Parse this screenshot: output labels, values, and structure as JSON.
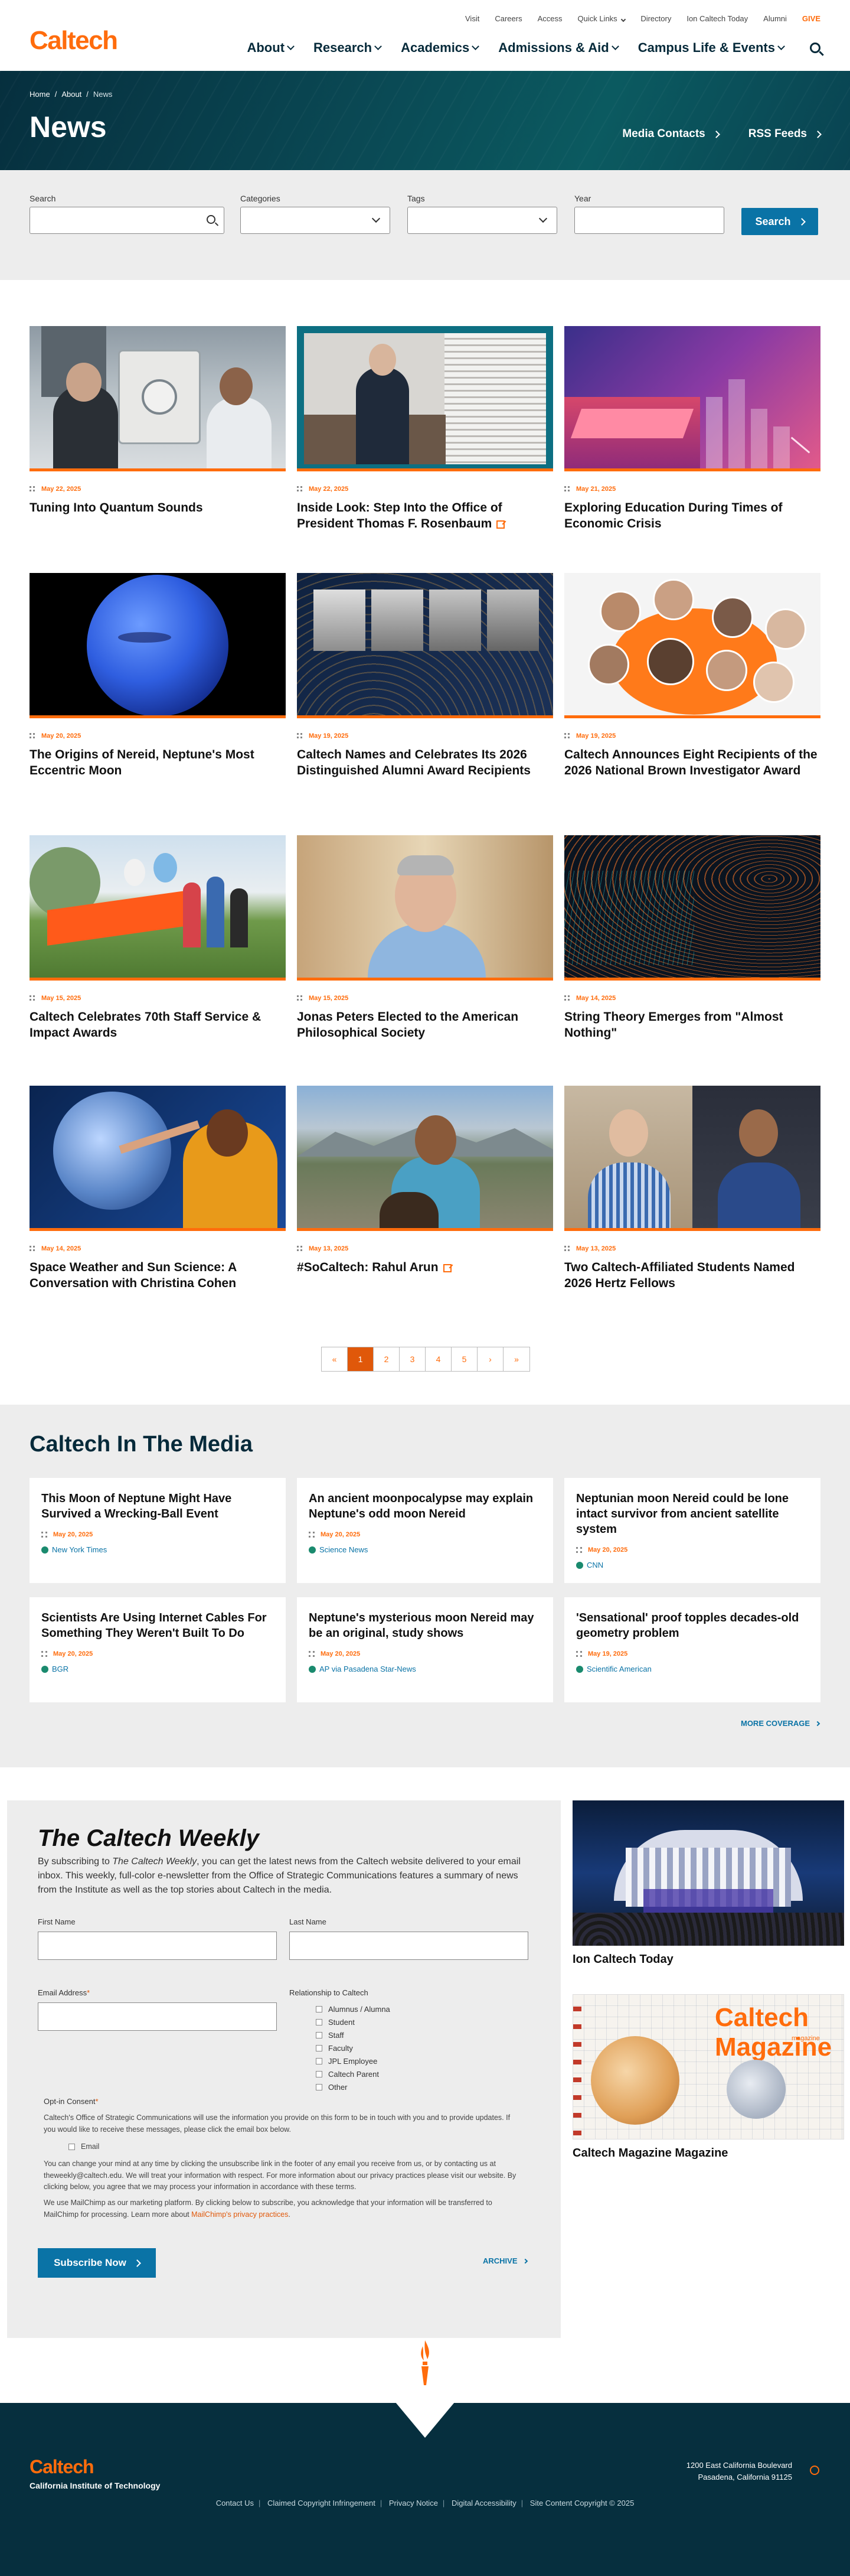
{
  "header": {
    "logo": "Caltech",
    "utility_links": [
      "Visit",
      "Careers",
      "Access",
      "Quick Links",
      "Directory",
      "Ion Caltech Today",
      "Alumni"
    ],
    "give": "GIVE",
    "main_nav": [
      "About",
      "Research",
      "Academics",
      "Admissions & Aid",
      "Campus Life & Events"
    ]
  },
  "breadcrumb": [
    "Home",
    "About",
    "News"
  ],
  "hero": {
    "title": "News",
    "links": [
      "Media Contacts",
      "RSS Feeds"
    ]
  },
  "filters": {
    "search_label": "Search",
    "categories_label": "Categories",
    "tags_label": "Tags",
    "year_label": "Year",
    "button": "Search"
  },
  "news": [
    {
      "date": "May 22, 2025",
      "title": "Tuning Into Quantum Sounds",
      "external": false
    },
    {
      "date": "May 22, 2025",
      "title": "Inside Look: Step Into the Office of President Thomas F. Rosenbaum",
      "external": true
    },
    {
      "date": "May 21, 2025",
      "title": "Exploring Education During Times of Economic Crisis",
      "external": false
    },
    {
      "date": "May 20, 2025",
      "title": "The Origins of Nereid, Neptune's Most Eccentric Moon",
      "external": false
    },
    {
      "date": "May 19, 2025",
      "title": "Caltech Names and Celebrates Its 2026 Distinguished Alumni Award Recipients",
      "external": false
    },
    {
      "date": "May 19, 2025",
      "title": "Caltech Announces Eight Recipients of the 2026 National Brown Investigator Award",
      "external": false
    },
    {
      "date": "May 15, 2025",
      "title": "Caltech Celebrates 70th Staff Service & Impact Awards",
      "external": false
    },
    {
      "date": "May 15, 2025",
      "title": "Jonas Peters Elected to the American Philosophical Society",
      "external": false
    },
    {
      "date": "May 14, 2025",
      "title": "String Theory Emerges from \"Almost Nothing\"",
      "external": false
    },
    {
      "date": "May 14, 2025",
      "title": "Space Weather and Sun Science: A Conversation with Christina Cohen",
      "external": false
    },
    {
      "date": "May 13, 2025",
      "title": "#SoCaltech: Rahul Arun",
      "external": true
    },
    {
      "date": "May 13, 2025",
      "title": "Two Caltech-Affiliated Students Named 2026 Hertz Fellows",
      "external": false
    }
  ],
  "pagination": [
    "«",
    "1",
    "2",
    "3",
    "4",
    "5",
    "›",
    "»"
  ],
  "media": {
    "heading": "Caltech In The Media",
    "items": [
      {
        "title": "This Moon of Neptune Might Have Survived a Wrecking-Ball Event",
        "date": "May 20, 2025",
        "source": "New York Times"
      },
      {
        "title": "An ancient moonpocalypse may explain Neptune's odd moon Nereid",
        "date": "May 20, 2025",
        "source": "Science News"
      },
      {
        "title": "Neptunian moon Nereid could be lone intact survivor from ancient satellite system",
        "date": "May 20, 2025",
        "source": "CNN"
      },
      {
        "title": "Scientists Are Using Internet Cables For Something They Weren't Built To Do",
        "date": "May 20, 2025",
        "source": "BGR"
      },
      {
        "title": "Neptune's mysterious moon Nereid may be an original, study shows",
        "date": "May 20, 2025",
        "source": "AP via Pasadena Star-News"
      },
      {
        "title": "'Sensational' proof topples decades-old geometry problem",
        "date": "May 19, 2025",
        "source": "Scientific American"
      }
    ],
    "more": "MORE COVERAGE"
  },
  "weekly": {
    "title": "The Caltech Weekly",
    "intro_pre": "By subscribing to ",
    "intro_em": "The Caltech Weekly",
    "intro_post": ", you can get the latest news from the Caltech website delivered to your email inbox. This weekly, full-color e-newsletter from the Office of Strategic Communications features a summary of news from the Institute as well as the top stories about Caltech in the media.",
    "first_name": "First Name",
    "last_name": "Last Name",
    "email": "Email Address",
    "relationship": "Relationship to Caltech",
    "relationship_options": [
      "Alumnus / Alumna",
      "Student",
      "Staff",
      "Faculty",
      "JPL Employee",
      "Caltech Parent",
      "Other"
    ],
    "optin_title": "Opt-in Consent",
    "optin_text": "Caltech's Office of Strategic Communications will use the information you provide on this form to be in touch with you and to provide updates. If you would like to receive these messages, please click the email box below.",
    "optin_email": "Email",
    "privacy_text": "You can change your mind at any time by clicking the unsubscribe link in the footer of any email you receive from us, or by contacting us at theweekly@caltech.edu. We will treat your information with respect. For more information about our privacy practices please visit our website. By clicking below, you agree that we may process your information in accordance with these terms.",
    "mailchimp_pre": "We use MailChimp as our marketing platform. By clicking below to subscribe, you acknowledge that your information will be transferred to MailChimp for processing. Learn more about ",
    "mailchimp_link": "MailChimp's privacy practices",
    "mailchimp_post": ".",
    "subscribe": "Subscribe Now",
    "archive": "ARCHIVE"
  },
  "side": [
    {
      "title": "Ion Caltech Today"
    },
    {
      "title": "Caltech Magazine",
      "magazine_word": "magazine"
    }
  ],
  "footer": {
    "logo": "Caltech",
    "name": "California Institute of Technology",
    "address1": "1200 East California Boulevard",
    "address2": "Pasadena, California 91125",
    "links": [
      "Contact Us",
      "Claimed Copyright Infringement",
      "Privacy Notice",
      "Digital Accessibility",
      "Site Content Copyright © 2025"
    ]
  },
  "colors": {
    "brand_orange": "#ff6c0c",
    "navy": "#062a3a",
    "link_blue": "#0a73a6",
    "teal_hero": "#0a4a55"
  }
}
